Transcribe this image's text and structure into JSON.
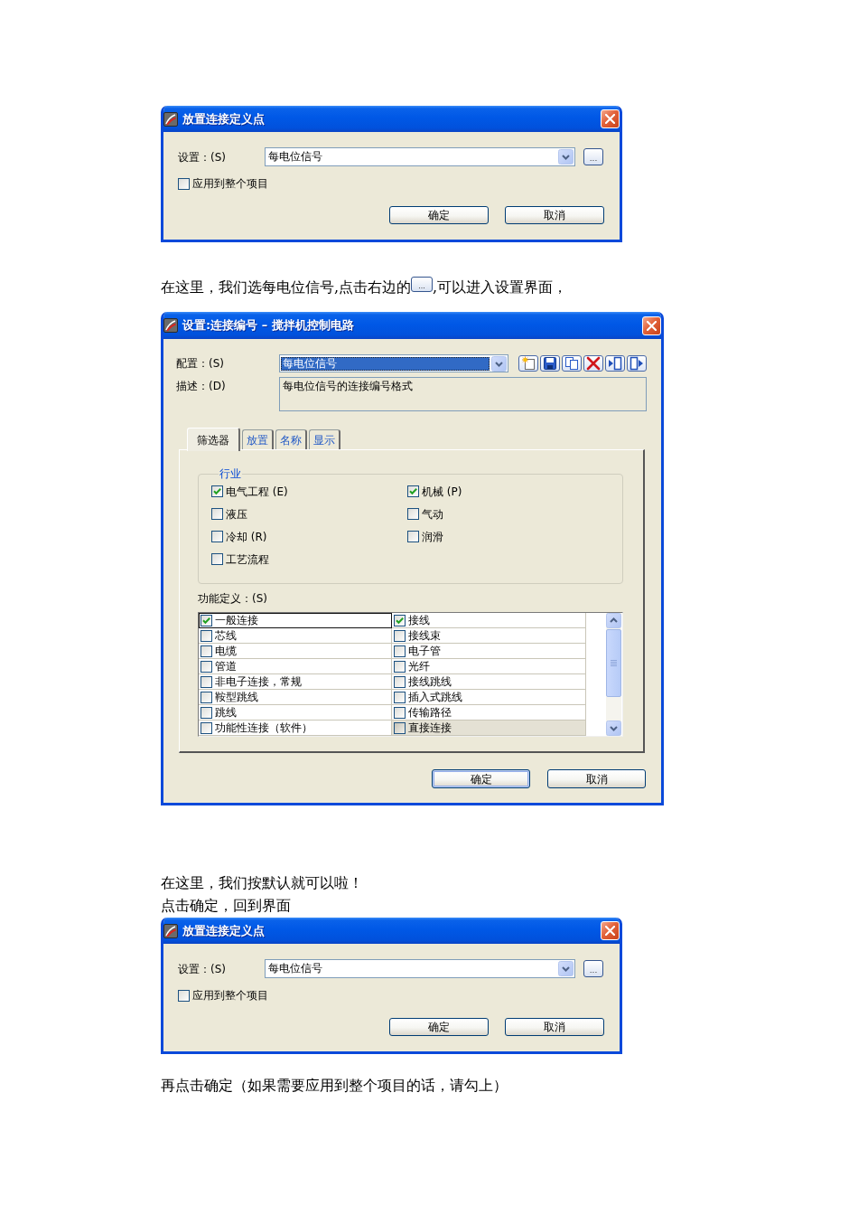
{
  "dialog_1": {
    "title": "放置连接定义点",
    "setting": {
      "label": "设置：(S)",
      "value": "每电位信号",
      "focused": false
    },
    "browse_button": "...",
    "apply_all": {
      "label": "应用到整个项目",
      "checked": false
    },
    "buttons": [
      "确定",
      "取消"
    ]
  },
  "note_1": {
    "before": "在这里，我们选每电位信号,点击右边的",
    "button_picture": "...",
    "after": ",可以进入设置界面，"
  },
  "dialog_2": {
    "title": "设置:连接编号 – 搅拌机控制电路",
    "config": {
      "label": "配置：(S)",
      "value": "每电位信号",
      "focused": true
    },
    "description": {
      "label": "描述：(D)",
      "value": "每电位信号的连接编号格式"
    },
    "tabs": [
      {
        "label": "筛选器",
        "selected": true
      },
      {
        "label": "放置",
        "selected": false
      },
      {
        "label": "名称",
        "selected": false
      },
      {
        "label": "显示",
        "selected": false
      }
    ],
    "industry": {
      "legend": "行业",
      "items": [
        {
          "label": "电气工程 (E)",
          "checked": true
        },
        {
          "label": "机械 (P)",
          "checked": true
        },
        {
          "label": "液压",
          "checked": false
        },
        {
          "label": "气动",
          "checked": false
        },
        {
          "label": "冷却 (R)",
          "checked": false
        },
        {
          "label": "润滑",
          "checked": false
        },
        {
          "label": "工艺流程",
          "checked": false
        }
      ]
    },
    "functions": {
      "label": "功能定义：(S)",
      "items": [
        {
          "label": "一般连接",
          "checked": true,
          "focused": true,
          "highlighted": false
        },
        {
          "label": "接线",
          "checked": true,
          "focused": false,
          "highlighted": false
        },
        {
          "label": "芯线",
          "checked": false,
          "focused": false,
          "highlighted": false
        },
        {
          "label": "接线束",
          "checked": false,
          "focused": false,
          "highlighted": false
        },
        {
          "label": "电缆",
          "checked": false,
          "focused": false,
          "highlighted": false
        },
        {
          "label": "电子管",
          "checked": false,
          "focused": false,
          "highlighted": false
        },
        {
          "label": "管道",
          "checked": false,
          "focused": false,
          "highlighted": false
        },
        {
          "label": "光纤",
          "checked": false,
          "focused": false,
          "highlighted": false
        },
        {
          "label": "非电子连接，常规",
          "checked": false,
          "focused": false,
          "highlighted": false
        },
        {
          "label": "接线跳线",
          "checked": false,
          "focused": false,
          "highlighted": false
        },
        {
          "label": "鞍型跳线",
          "checked": false,
          "focused": false,
          "highlighted": false
        },
        {
          "label": "插入式跳线",
          "checked": false,
          "focused": false,
          "highlighted": false
        },
        {
          "label": "跳线",
          "checked": false,
          "focused": false,
          "highlighted": false
        },
        {
          "label": "传输路径",
          "checked": false,
          "focused": false,
          "highlighted": false
        },
        {
          "label": "功能性连接（软件）",
          "checked": false,
          "focused": false,
          "highlighted": false
        },
        {
          "label": "直接连接",
          "checked": false,
          "focused": false,
          "highlighted": true
        }
      ]
    },
    "buttons": [
      {
        "label": "确定",
        "default": true
      },
      {
        "label": "取消",
        "default": false
      }
    ]
  },
  "note_2": [
    "在这里，我们按默认就可以啦！",
    "点击确定，回到界面"
  ],
  "dialog_3": {
    "title": "放置连接定义点",
    "setting": {
      "label": "设置：(S)",
      "value": "每电位信号",
      "focused": false
    },
    "browse_button": "...",
    "apply_all": {
      "label": "应用到整个项目",
      "checked": false
    },
    "buttons": [
      "确定",
      "取消"
    ]
  },
  "note_3": "再点击确定（如果需要应用到整个项目的话，请勾上）"
}
